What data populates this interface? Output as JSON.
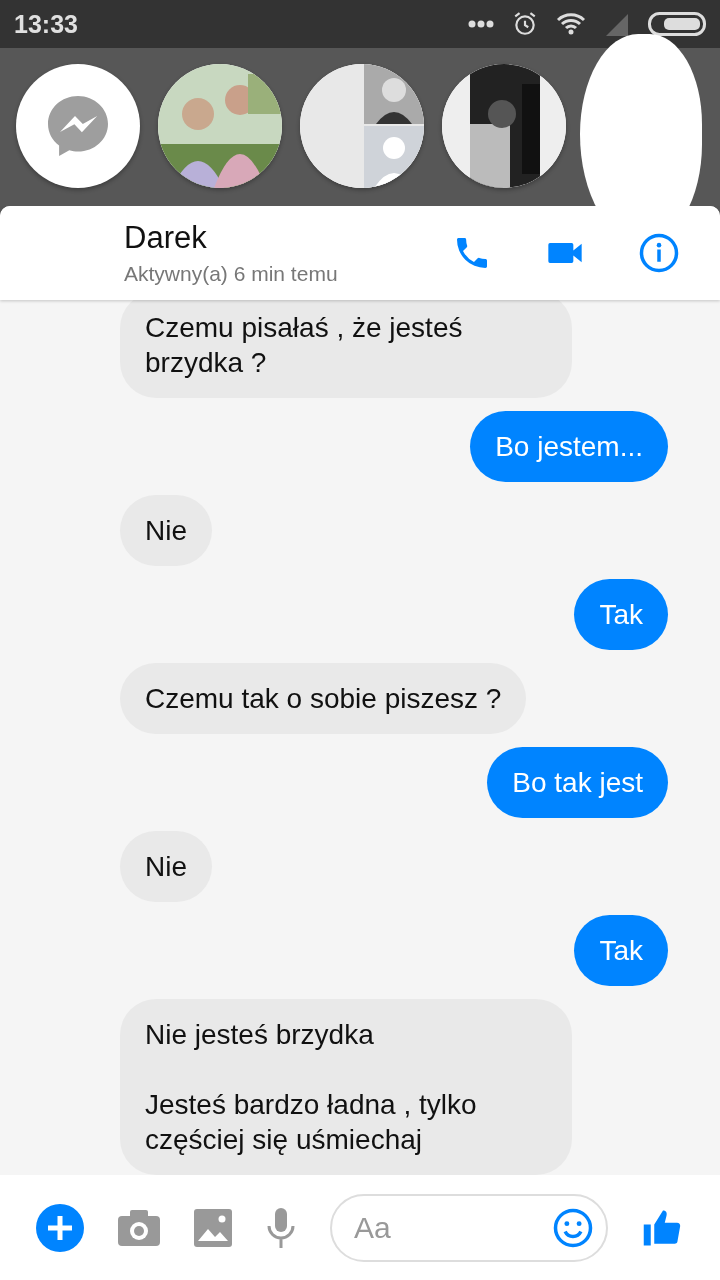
{
  "status_bar": {
    "time": "13:33"
  },
  "chat_heads": [
    {
      "kind": "messenger"
    },
    {
      "kind": "picture"
    },
    {
      "kind": "group"
    },
    {
      "kind": "picture"
    },
    {
      "kind": "redacted"
    }
  ],
  "conversation": {
    "name": "Darek",
    "status": "Aktywny(a) 6 min temu"
  },
  "messages": [
    {
      "outgoing": false,
      "text": "Czemu pisałaś , że jesteś brzydka ?"
    },
    {
      "outgoing": true,
      "text": "Bo jestem..."
    },
    {
      "outgoing": false,
      "text": "Nie"
    },
    {
      "outgoing": true,
      "text": "Tak"
    },
    {
      "outgoing": false,
      "text": "Czemu tak o sobie piszesz ?"
    },
    {
      "outgoing": true,
      "text": "Bo tak jest"
    },
    {
      "outgoing": false,
      "text": "Nie"
    },
    {
      "outgoing": true,
      "text": "Tak"
    },
    {
      "outgoing": false,
      "text": "Nie jesteś brzydka\n\nJesteś bardzo ładna , tylko częściej się uśmiechaj"
    }
  ],
  "composer": {
    "placeholder": "Aa"
  }
}
